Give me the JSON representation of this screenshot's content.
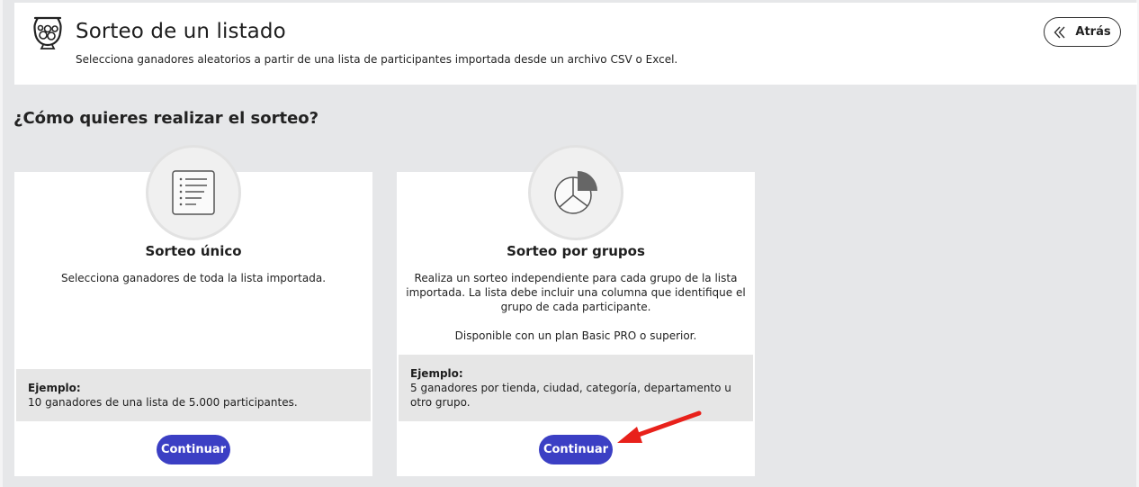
{
  "header": {
    "title": "Sorteo de un listado",
    "subtitle": "Selecciona ganadores aleatorios a partir de una lista de participantes importada desde un archivo CSV o Excel.",
    "back_label": "Atrás",
    "logo_icon": "raffle-drum-icon"
  },
  "question": "¿Cómo quieres realizar el sorteo?",
  "cards": [
    {
      "icon": "list-icon",
      "title": "Sorteo único",
      "desc_lines": [
        "Selecciona ganadores de toda la lista importada."
      ],
      "example_label": "Ejemplo:",
      "example_lines": [
        "10 ganadores de una lista de 5.000 participantes."
      ],
      "button_label": "Continuar"
    },
    {
      "icon": "pie-chart-icon",
      "title": "Sorteo por grupos",
      "desc_lines": [
        "Realiza un sorteo independiente para cada grupo de la lista",
        "importada. La lista debe incluir una columna que identifique el",
        "grupo de cada participante."
      ],
      "availability": "Disponible con un plan Basic PRO o superior.",
      "example_label": "Ejemplo:",
      "example_lines": [
        "5 ganadores por tienda, ciudad, categoría, departamento u",
        "otro grupo."
      ],
      "button_label": "Continuar"
    }
  ],
  "colors": {
    "primary_button": "#3b3fc4",
    "annotation_arrow": "#e8211b",
    "background": "#e6e7e9"
  }
}
